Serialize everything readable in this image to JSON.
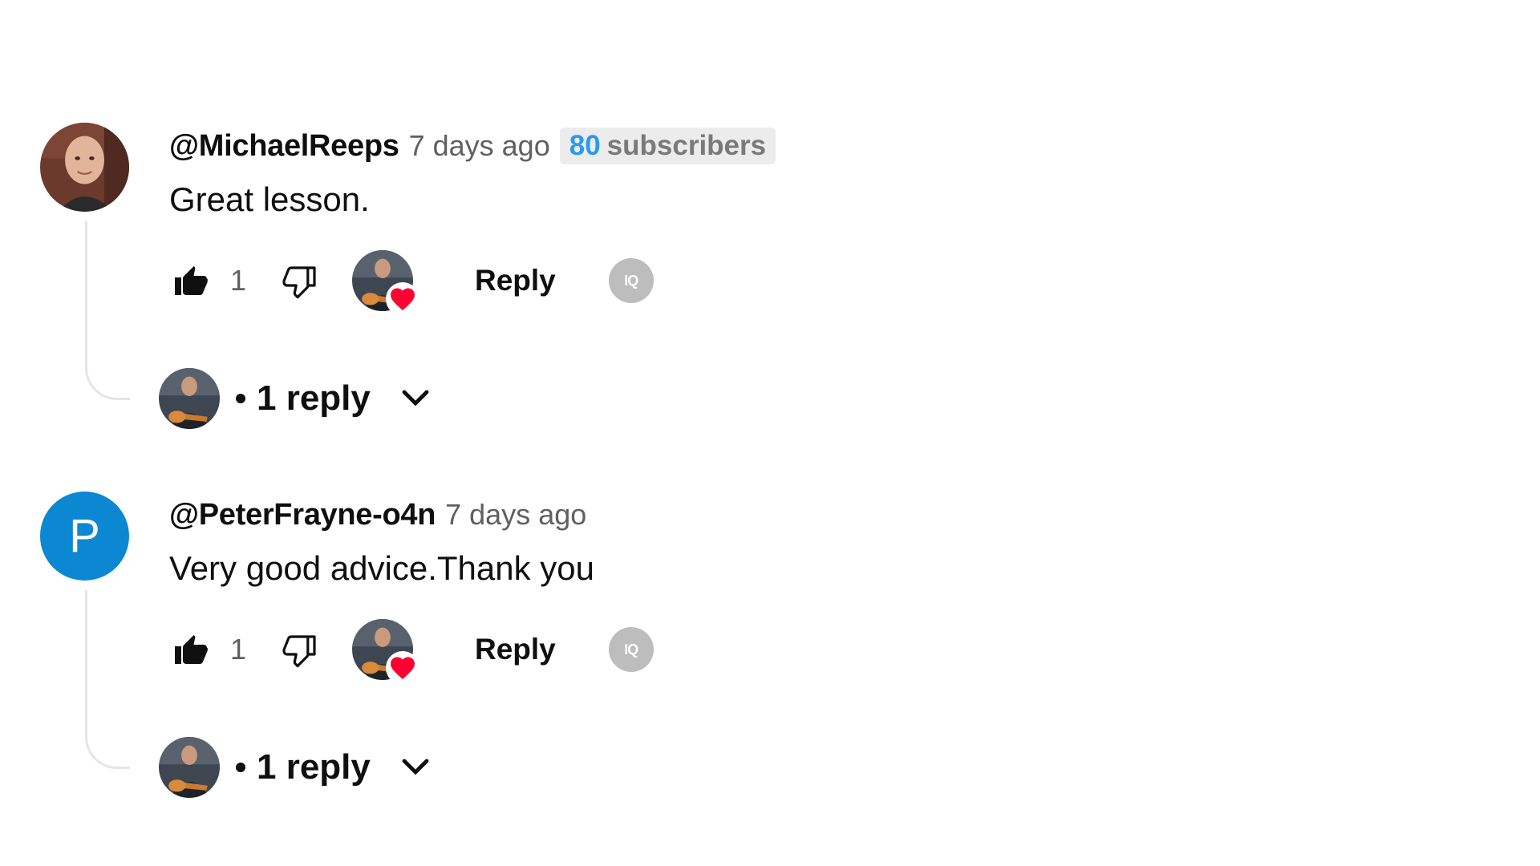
{
  "comments": [
    {
      "author": "@MichaelReeps",
      "time": "7 days ago",
      "subscribers": {
        "count": "80",
        "label": "subscribers"
      },
      "text": "Great lesson.",
      "likes": "1",
      "reply_label": "Reply",
      "replies_label": "1 reply",
      "avatar_icon": "person-photo-avatar"
    },
    {
      "author": "@PeterFrayne-o4n",
      "time": "7 days ago",
      "avatar_letter": "P",
      "avatar_color": "#0b88d1",
      "text": "Very good advice.Thank you",
      "likes": "1",
      "reply_label": "Reply",
      "replies_label": "1 reply"
    }
  ],
  "colors": {
    "subscriber_count": "#2a9af0",
    "heart": "#ff0033",
    "timestamp": "#606060"
  },
  "icons": {
    "like": "thumbs-up-icon",
    "dislike": "thumbs-down-icon",
    "creator_heart": "creator-heart-icon",
    "extension": "extension-icon",
    "expand": "chevron-down-icon"
  },
  "extension_label": "IQ"
}
